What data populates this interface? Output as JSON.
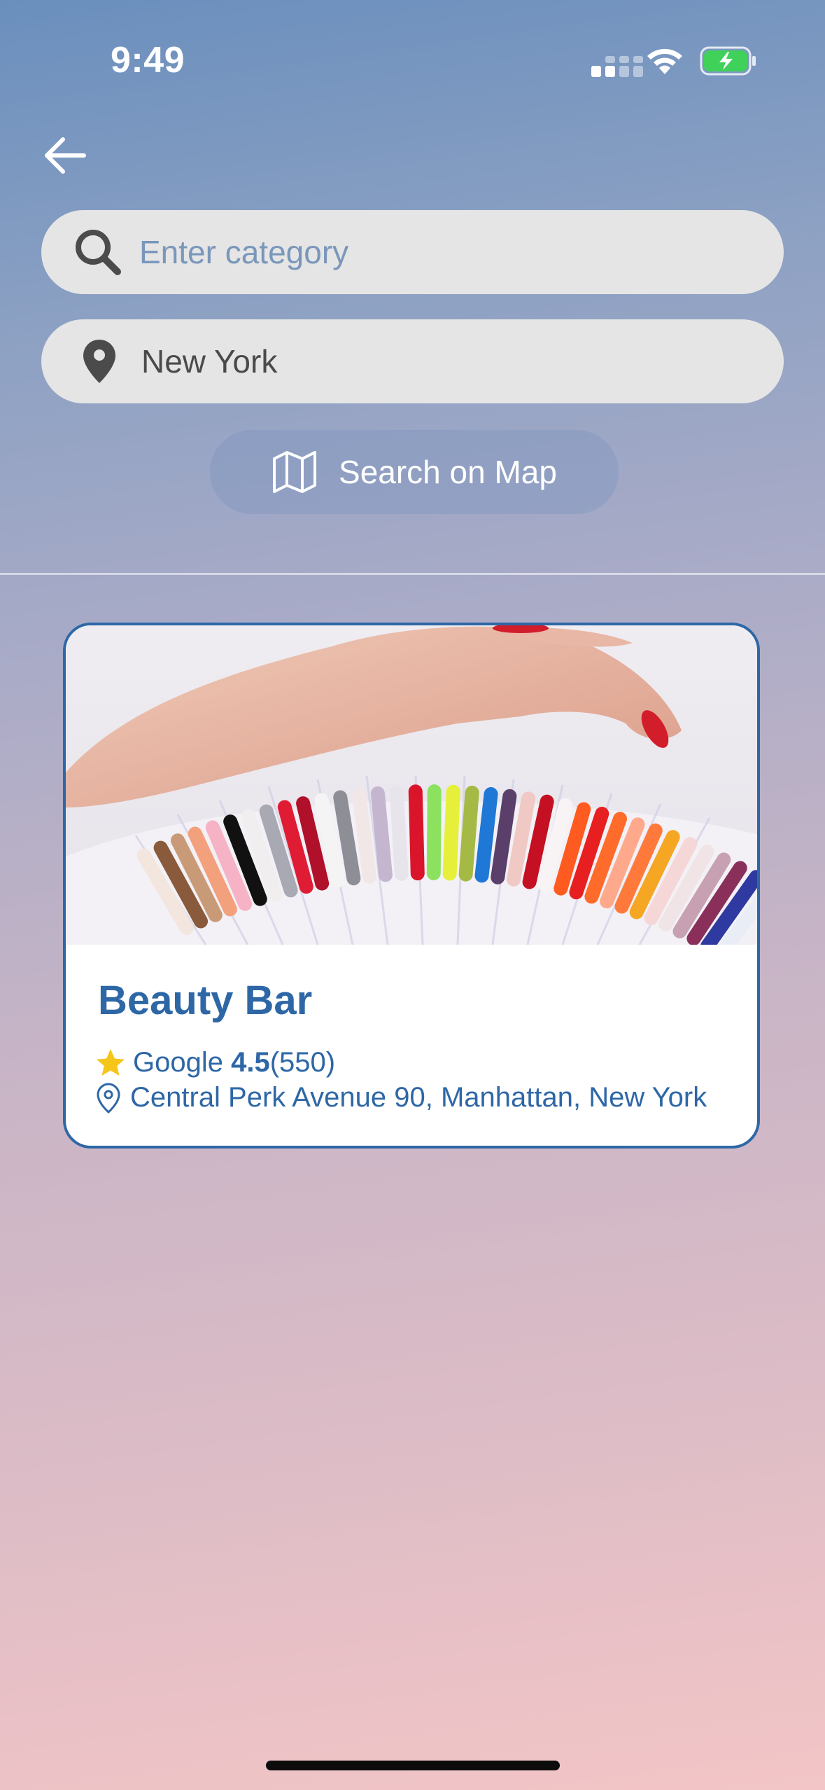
{
  "status_bar": {
    "time": "9:49"
  },
  "search": {
    "placeholder": "Enter category",
    "value": ""
  },
  "location": {
    "value": "New York"
  },
  "map_button": {
    "label": "Search on Map"
  },
  "results": [
    {
      "name": "Beauty Bar",
      "rating_source": "Google",
      "rating": "4.5",
      "reviews": "(550)",
      "address": "Central Perk Avenue 90, Manhattan, New York"
    }
  ],
  "icons": {
    "back": "arrow-left-icon",
    "search": "search-icon",
    "location": "location-pin-icon",
    "map": "map-icon",
    "star": "star-icon",
    "address": "location-pin-outline-icon"
  },
  "colors": {
    "accent": "#2e67a6",
    "field_bg": "#e5e5e5",
    "star": "#f5c518",
    "battery": "#3fd15a"
  }
}
